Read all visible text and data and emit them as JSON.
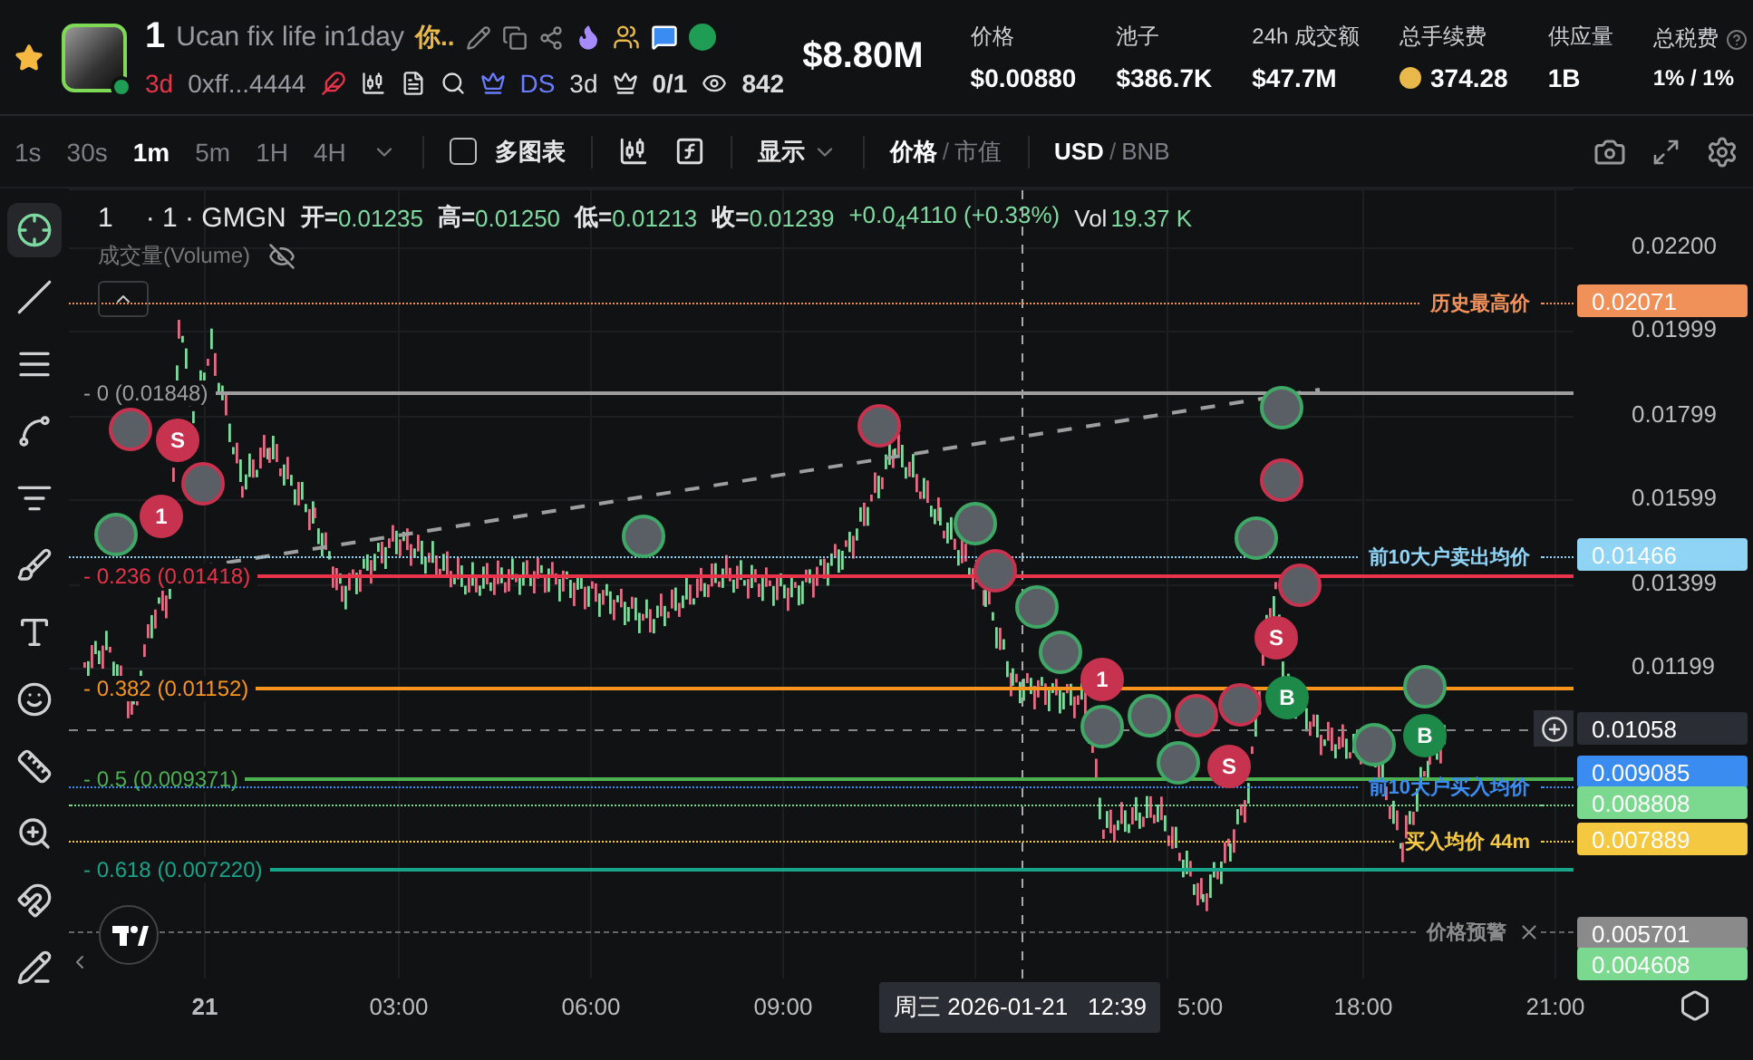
{
  "header": {
    "favorite": true,
    "token_number": "1",
    "token_name": "Ucan fix life in1day",
    "token_name_cn": "你..",
    "age": "3d",
    "address": "0xff...4444",
    "ds_label": "DS",
    "ds_age": "3d",
    "holders_ratio": "0/1",
    "watchers": "842",
    "market_cap": "$8.80M",
    "stats": [
      {
        "kind": "plain",
        "label": "价格",
        "value": "$0.00880"
      },
      {
        "kind": "plain",
        "label": "池子",
        "value": "$386.7K"
      },
      {
        "kind": "plain",
        "label": "24h 成交额",
        "value": "$47.7M"
      },
      {
        "kind": "coin",
        "label": "总手续费",
        "value": "374.28"
      },
      {
        "kind": "plain",
        "label": "供应量",
        "value": "1B"
      },
      {
        "kind": "tax",
        "label": "总税费",
        "value": "1% / 1%"
      }
    ]
  },
  "toolbar": {
    "intervals": [
      {
        "label": "1s",
        "selected": false
      },
      {
        "label": "30s",
        "selected": false
      },
      {
        "label": "1m",
        "selected": true
      },
      {
        "label": "5m",
        "selected": false
      },
      {
        "label": "1H",
        "selected": false
      },
      {
        "label": "4H",
        "selected": false
      }
    ],
    "multi_chart": {
      "label": "多图表",
      "checked": false
    },
    "display": "显示",
    "price_mode": {
      "separator": "/",
      "options": [
        {
          "label": "价格",
          "selected": true
        },
        {
          "label": "市值",
          "selected": false
        }
      ]
    },
    "currency": {
      "separator": "/",
      "options": [
        {
          "label": "USD",
          "selected": true
        },
        {
          "label": "BNB",
          "selected": false
        }
      ]
    }
  },
  "tools": [
    {
      "kind": "crosshair",
      "selected": true
    },
    {
      "kind": "line",
      "selected": false
    },
    {
      "kind": "hlines",
      "selected": false
    },
    {
      "kind": "pattern",
      "selected": false
    },
    {
      "kind": "fib",
      "selected": false
    },
    {
      "kind": "brush",
      "selected": false
    },
    {
      "kind": "text",
      "selected": false
    },
    {
      "kind": "emoji",
      "selected": false
    },
    {
      "kind": "ruler",
      "selected": false
    },
    {
      "kind": "zoom",
      "selected": false
    },
    {
      "kind": "magnet",
      "selected": false
    },
    {
      "kind": "lock",
      "selected": false
    }
  ],
  "chart": {
    "symbol": "1",
    "source": "· 1 · GMGN",
    "ohlc": [
      {
        "label": "开=",
        "value": "0.01235"
      },
      {
        "label": "高=",
        "value": "0.01250"
      },
      {
        "label": "低=",
        "value": "0.01213"
      },
      {
        "label": "收=",
        "value": "0.01239"
      }
    ],
    "change": "+0.0$_{4}$4110 (+0.33%)",
    "volume": {
      "label": "Vol",
      "value": "19.37 K"
    },
    "volume_label": "成交量(Volume)",
    "volume_hidden": true,
    "fib_levels": [
      {
        "label": "- 0 (0.01848)",
        "color": "#9e9e9e"
      },
      {
        "label": "- 0.236 (0.01418)",
        "color": "#e8334a"
      },
      {
        "label": "- 0.382 (0.01152)",
        "color": "#f7941d"
      },
      {
        "label": "- 0.5 (0.009371)",
        "color": "#4caf50"
      },
      {
        "label": "- 0.618 (0.007220)",
        "color": "#17a589"
      }
    ],
    "price_lines": [
      {
        "label": "历史最高价",
        "tag": "0.02071",
        "color": "#f0915a"
      },
      {
        "label": "前10大户卖出均价",
        "tag": "0.01466",
        "color": "#8fd3f5"
      },
      {
        "label": "前10大户买入均价",
        "tag": "0.009085",
        "color": "#3b8cf0"
      },
      {
        "tag": "0.008808",
        "color": "#7bd88f"
      },
      {
        "label": "买入均价 44m",
        "tag": "0.007889",
        "color": "#f5c842"
      },
      {
        "label": "价格预警",
        "tag": "0.005701",
        "color": "#8a8a8a"
      },
      {
        "tag": "0.004608",
        "color": "#7bd88f"
      }
    ],
    "crosshair": {
      "price": "0.01058",
      "time": "周三 2026-01-21   12:39"
    },
    "price_axis": [
      "0.02200",
      "0.01999",
      "0.01799",
      "0.01599",
      "0.01399",
      "0.01199"
    ],
    "time_axis": [
      "21",
      "03:00",
      "06:00",
      "09:00",
      "5:00",
      "18:00",
      "21:00"
    ],
    "markers": [
      {
        "kind": "avatar",
        "color": "#c7334f"
      },
      {
        "kind": "letter",
        "text": "S",
        "color": "#c7334f"
      },
      {
        "kind": "avatar",
        "color": "#c7334f"
      },
      {
        "kind": "letter",
        "text": "1",
        "color": "#c7334f"
      },
      {
        "kind": "avatar",
        "color": "#3fa866"
      },
      {
        "kind": "avatar",
        "color": "#3fa866"
      },
      {
        "kind": "avatar",
        "color": "#c7334f"
      },
      {
        "kind": "avatar",
        "color": "#3fa866"
      },
      {
        "kind": "avatar",
        "color": "#c7334f"
      },
      {
        "kind": "avatar",
        "color": "#3fa866"
      },
      {
        "kind": "avatar",
        "color": "#3fa866"
      },
      {
        "kind": "letter",
        "text": "1",
        "color": "#c7334f"
      },
      {
        "kind": "avatar",
        "color": "#3fa866"
      },
      {
        "kind": "avatar",
        "color": "#3fa866"
      },
      {
        "kind": "avatar",
        "color": "#3fa866"
      },
      {
        "kind": "avatar",
        "color": "#c7334f"
      },
      {
        "kind": "avatar",
        "color": "#c7334f"
      },
      {
        "kind": "letter",
        "text": "S",
        "color": "#c7334f"
      },
      {
        "kind": "avatar",
        "color": "#3fa866"
      },
      {
        "kind": "avatar",
        "color": "#c7334f"
      },
      {
        "kind": "avatar",
        "color": "#3fa866"
      },
      {
        "kind": "avatar",
        "color": "#c7334f"
      },
      {
        "kind": "letter",
        "text": "S",
        "color": "#c7334f"
      },
      {
        "kind": "letter",
        "text": "B",
        "color": "#1e8a4a"
      },
      {
        "kind": "avatar",
        "color": "#3fa866"
      },
      {
        "kind": "letter",
        "text": "B",
        "color": "#1e8a4a"
      },
      {
        "kind": "avatar",
        "color": "#3fa866"
      }
    ]
  }
}
